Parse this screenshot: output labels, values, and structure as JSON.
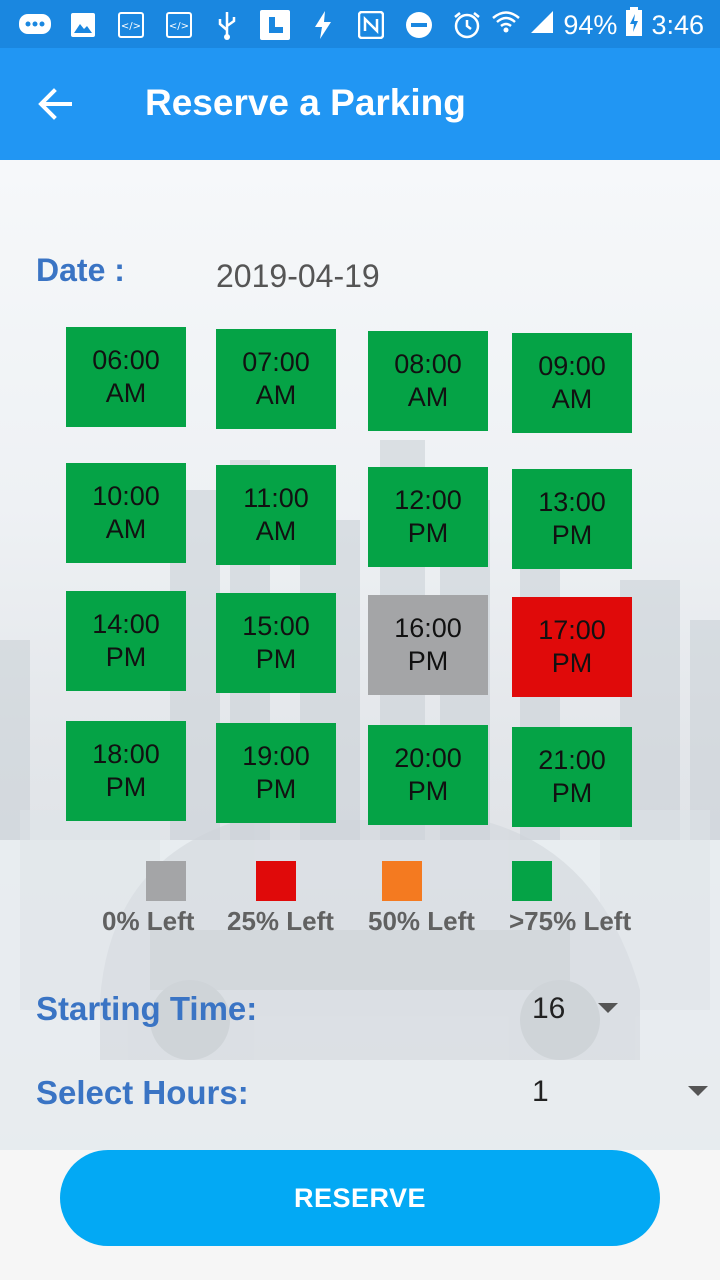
{
  "status_bar": {
    "icons": [
      "chat-icon",
      "image-icon",
      "code-icon",
      "code-icon",
      "usb-icon",
      "screenshot-icon",
      "flash-icon",
      "nfc-icon",
      "dnd-icon",
      "alarm-icon",
      "wifi-icon",
      "signal-icon",
      "battery-icon"
    ],
    "battery": "94%",
    "time": "3:46"
  },
  "appbar": {
    "title": "Reserve a Parking"
  },
  "date": {
    "label": "Date :",
    "value": "2019-04-19"
  },
  "slots": [
    {
      "time": "06:00",
      "period": "AM",
      "status": "green"
    },
    {
      "time": "07:00",
      "period": "AM",
      "status": "green"
    },
    {
      "time": "08:00",
      "period": "AM",
      "status": "green"
    },
    {
      "time": "09:00",
      "period": "AM",
      "status": "green"
    },
    {
      "time": "10:00",
      "period": "AM",
      "status": "green"
    },
    {
      "time": "11:00",
      "period": "AM",
      "status": "green"
    },
    {
      "time": "12:00",
      "period": "PM",
      "status": "green"
    },
    {
      "time": "13:00",
      "period": "PM",
      "status": "green"
    },
    {
      "time": "14:00",
      "period": "PM",
      "status": "green"
    },
    {
      "time": "15:00",
      "period": "PM",
      "status": "green"
    },
    {
      "time": "16:00",
      "period": "PM",
      "status": "gray"
    },
    {
      "time": "17:00",
      "period": "PM",
      "status": "red"
    },
    {
      "time": "18:00",
      "period": "PM",
      "status": "green"
    },
    {
      "time": "19:00",
      "period": "PM",
      "status": "green"
    },
    {
      "time": "20:00",
      "period": "PM",
      "status": "green"
    },
    {
      "time": "21:00",
      "period": "PM",
      "status": "green"
    }
  ],
  "legend": [
    {
      "label": "0% Left",
      "color": "#a4a5a7"
    },
    {
      "label": "25% Left",
      "color": "#e00a0a"
    },
    {
      "label": "50% Left",
      "color": "#f47a20"
    },
    {
      "label": ">75% Left",
      "color": "#05a346"
    }
  ],
  "starting_time": {
    "label": "Starting Time:",
    "value": "16"
  },
  "select_hours": {
    "label": "Select Hours:",
    "value": "1"
  },
  "reserve_button": {
    "label": "RESERVE"
  },
  "colors": {
    "appbar": "#2196f3",
    "accent_text": "#3a74c4",
    "button": "#03a9f4"
  }
}
